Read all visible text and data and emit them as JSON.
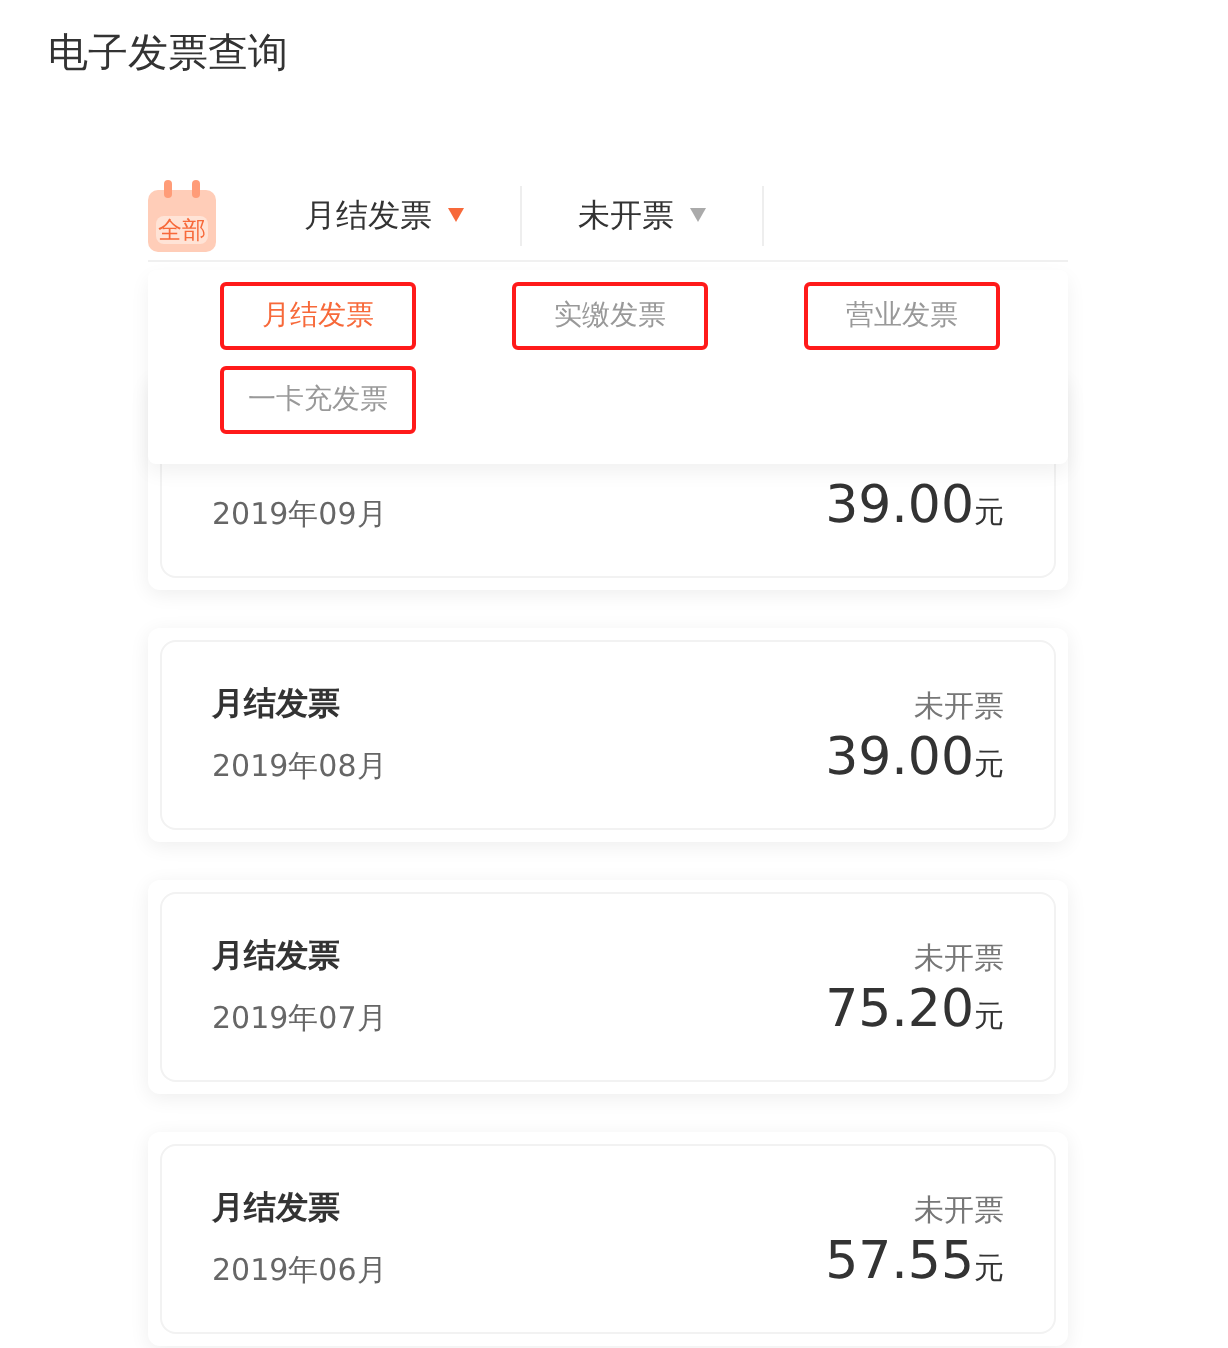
{
  "page": {
    "title": "电子发票查询"
  },
  "filter_bar": {
    "all_button": {
      "label": "全部"
    },
    "tabs": [
      {
        "label": "月结发票",
        "expanded": true
      },
      {
        "label": "未开票",
        "expanded": false
      }
    ]
  },
  "dropdown": {
    "options": [
      {
        "label": "月结发票",
        "selected": true
      },
      {
        "label": "实缴发票",
        "selected": false
      },
      {
        "label": "营业发票",
        "selected": false
      },
      {
        "label": "一卡充发票",
        "selected": false
      }
    ]
  },
  "invoices": [
    {
      "date": "2019年09月",
      "amount": "39.00",
      "unit": "元"
    },
    {
      "title": "月结发票",
      "status": "未开票",
      "date": "2019年08月",
      "amount": "39.00",
      "unit": "元"
    },
    {
      "title": "月结发票",
      "status": "未开票",
      "date": "2019年07月",
      "amount": "75.20",
      "unit": "元"
    },
    {
      "title": "月结发票",
      "status": "未开票",
      "date": "2019年06月",
      "amount": "57.55",
      "unit": "元"
    }
  ]
}
